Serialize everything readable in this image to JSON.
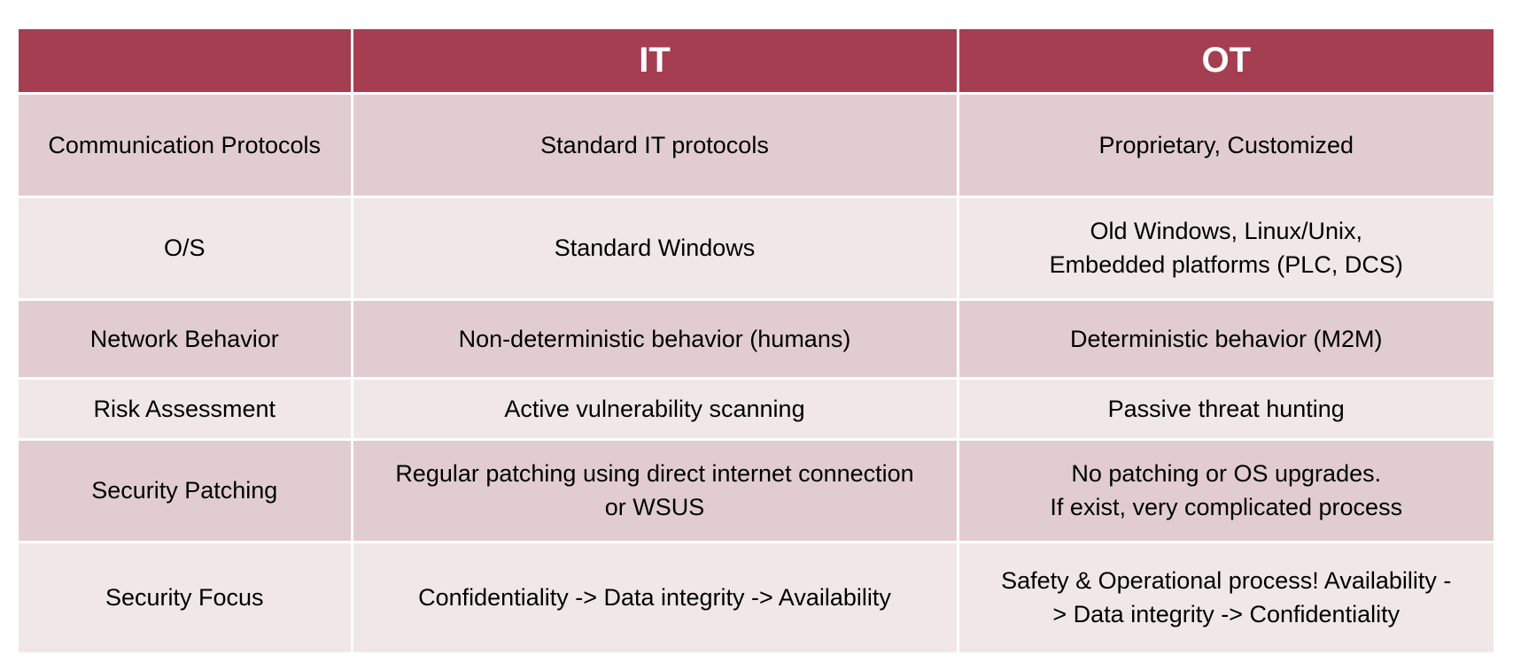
{
  "table": {
    "header": {
      "corner": "",
      "col_it": "IT",
      "col_ot": "OT"
    },
    "rows": [
      {
        "label": "Communication Protocols",
        "it": "Standard IT protocols",
        "ot": "Proprietary, Customized"
      },
      {
        "label": "O/S",
        "it": "Standard Windows",
        "ot": "Old Windows, Linux/Unix,\nEmbedded platforms (PLC, DCS)"
      },
      {
        "label": "Network Behavior",
        "it": "Non-deterministic behavior (humans)",
        "ot": "Deterministic behavior (M2M)"
      },
      {
        "label": "Risk Assessment",
        "it": "Active vulnerability scanning",
        "ot": "Passive threat hunting"
      },
      {
        "label": "Security Patching",
        "it": "Regular patching using direct internet connection\nor WSUS",
        "ot": "No patching or OS upgrades.\nIf exist, very complicated process"
      },
      {
        "label": "Security Focus",
        "it": "Confidentiality -> Data integrity -> Availability",
        "ot": "Safety & Operational process! Availability -\n> Data integrity -> Confidentiality"
      }
    ]
  },
  "colors": {
    "header_bg": "#a63e51",
    "header_text": "#ffffff",
    "row_dark": "#e1cdd1",
    "row_light": "#f0e7e8"
  }
}
